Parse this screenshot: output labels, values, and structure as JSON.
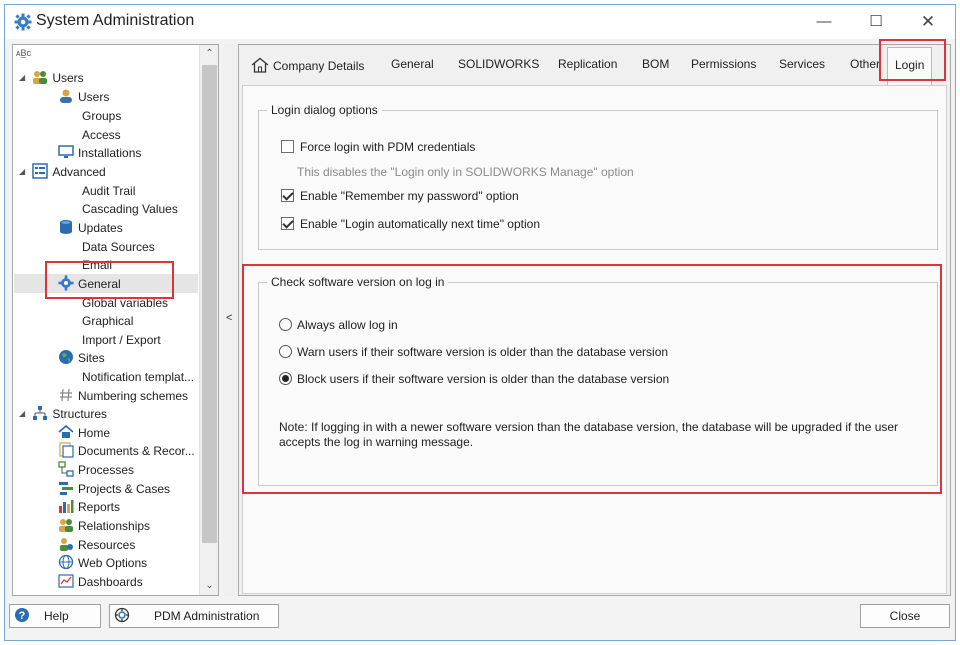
{
  "window": {
    "title": "System Administration",
    "minimize": "—",
    "maximize": "☐",
    "close": "✕"
  },
  "tree": {
    "toolbar_label": "ᴀB̲c",
    "scroll_up": "⌃",
    "scroll_down": "⌄",
    "items": [
      {
        "label": "Users",
        "icon": "users-group-icon",
        "expander": "◢"
      },
      {
        "label": "Users",
        "icon": "user-icon"
      },
      {
        "label": "Groups",
        "icon": ""
      },
      {
        "label": "Access",
        "icon": ""
      },
      {
        "label": "Installations",
        "icon": "monitor-icon"
      },
      {
        "label": "Advanced",
        "icon": "advanced-list-icon",
        "expander": "◢"
      },
      {
        "label": "Audit Trail",
        "icon": ""
      },
      {
        "label": "Cascading Values",
        "icon": ""
      },
      {
        "label": "Updates",
        "icon": "database-icon"
      },
      {
        "label": "Data Sources",
        "icon": ""
      },
      {
        "label": "Email",
        "icon": ""
      },
      {
        "label": "General",
        "icon": "gear-icon"
      },
      {
        "label": "Global variables",
        "icon": ""
      },
      {
        "label": "Graphical",
        "icon": ""
      },
      {
        "label": "Import / Export",
        "icon": ""
      },
      {
        "label": "Sites",
        "icon": "globe-icon"
      },
      {
        "label": "Notification templat...",
        "icon": ""
      },
      {
        "label": "Numbering schemes",
        "icon": "hash-icon"
      },
      {
        "label": "Structures",
        "icon": "hierarchy-icon",
        "expander": "◢"
      },
      {
        "label": "Home",
        "icon": "home-icon"
      },
      {
        "label": "Documents & Recor...",
        "icon": "documents-icon"
      },
      {
        "label": "Processes",
        "icon": "process-icon"
      },
      {
        "label": "Projects & Cases",
        "icon": "projects-icon"
      },
      {
        "label": "Reports",
        "icon": "reports-icon"
      },
      {
        "label": "Relationships",
        "icon": "relationships-icon"
      },
      {
        "label": "Resources",
        "icon": "resources-icon"
      },
      {
        "label": "Web Options",
        "icon": "web-icon"
      },
      {
        "label": "Dashboards",
        "icon": "dashboard-icon"
      }
    ]
  },
  "splitter": {
    "arrow": "<"
  },
  "tabs": [
    {
      "label": "Company Details"
    },
    {
      "label": "General"
    },
    {
      "label": "SOLIDWORKS"
    },
    {
      "label": "Replication"
    },
    {
      "label": "BOM"
    },
    {
      "label": "Permissions"
    },
    {
      "label": "Services"
    },
    {
      "label": "Other"
    },
    {
      "label": "Login"
    }
  ],
  "login_options": {
    "title": "Login dialog options",
    "force_login": {
      "label": "Force login with PDM credentials",
      "checked": false
    },
    "force_hint": "This disables the \"Login only in SOLIDWORKS Manage\" option",
    "remember_password": {
      "label": "Enable \"Remember my password\" option",
      "checked": true
    },
    "auto_login": {
      "label": "Enable \"Login automatically next time\" option",
      "checked": true
    }
  },
  "version_check": {
    "title": "Check software version on log in",
    "options": [
      {
        "label": "Always allow log in",
        "selected": false
      },
      {
        "label": "Warn users if their software version is older than the database version",
        "selected": false
      },
      {
        "label": "Block users if their software version is older than the database version",
        "selected": true
      }
    ],
    "note": "Note: If logging in with a newer software version than the database version, the database will be upgraded if the user accepts the log in warning message."
  },
  "bottom": {
    "help": "Help",
    "pdm_admin": "PDM Administration",
    "close": "Close"
  },
  "colors": {
    "highlight_red": "#e0323a",
    "window_border": "#7aa7d6",
    "icon_blue": "#2b6cb0",
    "gear_blue": "#3a7bc8"
  }
}
